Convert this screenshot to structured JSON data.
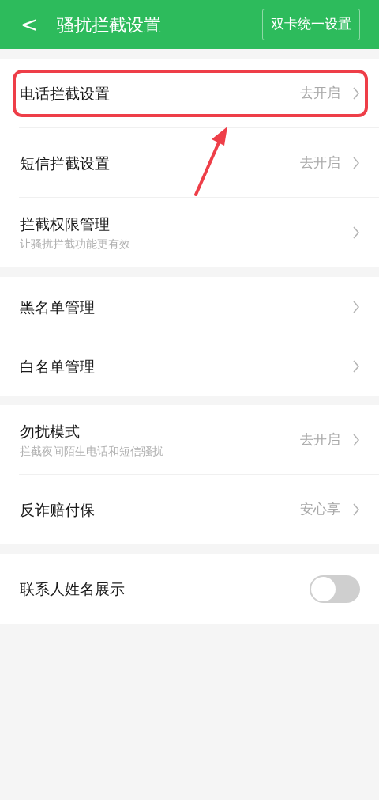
{
  "header": {
    "back": "<",
    "title": "骚扰拦截设置",
    "action": "双卡统一设置"
  },
  "groups": [
    {
      "rows": [
        {
          "kind": "nav",
          "title": "电话拦截设置",
          "value": "去开启",
          "highlighted": true
        },
        {
          "kind": "nav",
          "title": "短信拦截设置",
          "value": "去开启",
          "highlighted": false
        },
        {
          "kind": "nav",
          "title": "拦截权限管理",
          "subtitle": "让骚扰拦截功能更有效",
          "highlighted": false
        }
      ]
    },
    {
      "rows": [
        {
          "kind": "nav",
          "title": "黑名单管理",
          "highlighted": false
        },
        {
          "kind": "nav",
          "title": "白名单管理",
          "highlighted": false
        }
      ]
    },
    {
      "rows": [
        {
          "kind": "nav",
          "title": "勿扰模式",
          "subtitle": "拦截夜间陌生电话和短信骚扰",
          "value": "去开启",
          "highlighted": false
        },
        {
          "kind": "nav",
          "title": "反诈赔付保",
          "value": "安心享",
          "highlighted": false
        }
      ]
    },
    {
      "rows": [
        {
          "kind": "toggle",
          "title": "联系人姓名展示",
          "on": false,
          "highlighted": false
        }
      ]
    }
  ]
}
